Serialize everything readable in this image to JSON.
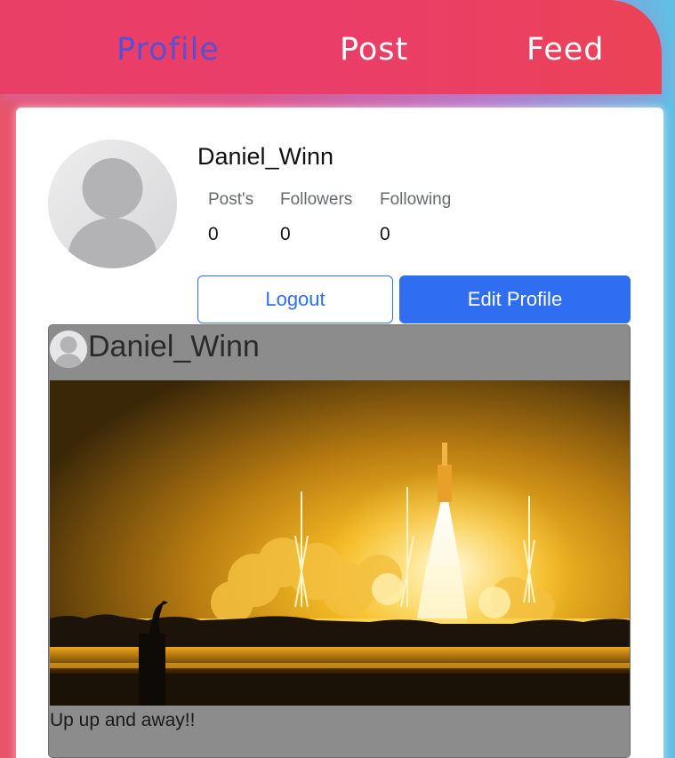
{
  "nav": {
    "profile": "Profile",
    "post": "Post",
    "feed": "Feed",
    "active": "profile"
  },
  "profile": {
    "username": "Daniel_Winn",
    "stats": {
      "posts_label": "Post's",
      "posts_value": "0",
      "followers_label": "Followers",
      "followers_value": "0",
      "following_label": "Following",
      "following_value": "0"
    },
    "logout_label": "Logout",
    "edit_label": "Edit Profile"
  },
  "post": {
    "username": "Daniel_Winn",
    "caption": "Up up and away!!",
    "image_icon": "rocket-launch-photo"
  },
  "colors": {
    "nav_active": "#5b4fd0",
    "primary_button": "#2f6ef0",
    "nav_gradient_start": "#e93f66",
    "nav_gradient_end": "#ec4257"
  }
}
